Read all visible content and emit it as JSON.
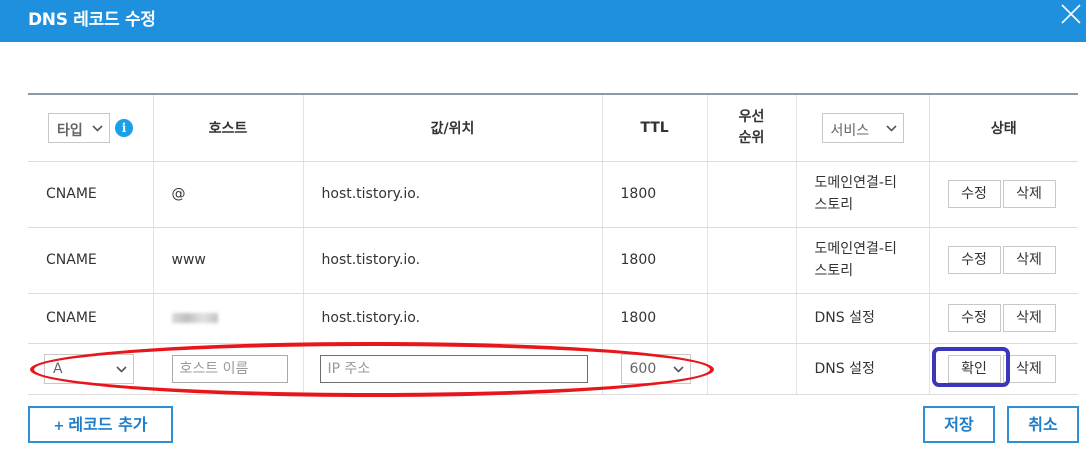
{
  "dialog": {
    "title": "DNS 레코드 수정"
  },
  "header": {
    "type_select": "타입",
    "host": "호스트",
    "value": "값/위치",
    "ttl": "TTL",
    "priority": "우선\n순위",
    "service_select": "서비스",
    "status": "상태"
  },
  "rows": [
    {
      "type": "CNAME",
      "host": "@",
      "value": "host.tistory.io.",
      "ttl": "1800",
      "service": "도메인연결-티\n스토리",
      "edit": "수정",
      "delete": "삭제"
    },
    {
      "type": "CNAME",
      "host": "www",
      "value": "host.tistory.io.",
      "ttl": "1800",
      "service": "도메인연결-티\n스토리",
      "edit": "수정",
      "delete": "삭제"
    },
    {
      "type": "CNAME",
      "host": "",
      "value": "host.tistory.io.",
      "ttl": "1800",
      "service": "DNS 설정",
      "edit": "수정",
      "delete": "삭제"
    }
  ],
  "new_row": {
    "type_value": "A",
    "host_placeholder": "호스트 이름",
    "ip_placeholder": "IP 주소",
    "ttl_value": "600",
    "service": "DNS 설정",
    "confirm": "확인",
    "delete": "삭제"
  },
  "footer": {
    "add_record": "레코드 추가",
    "add_plus": "+",
    "save": "저장",
    "cancel": "취소"
  },
  "icons": {
    "close": "close-icon",
    "info": "info-icon",
    "chevron": "chevron-down-icon"
  },
  "colors": {
    "titlebar": "#1e90dd",
    "accent": "#2e8ed6",
    "highlight_red": "#e8161b",
    "highlight_blue": "#3d36b8"
  }
}
